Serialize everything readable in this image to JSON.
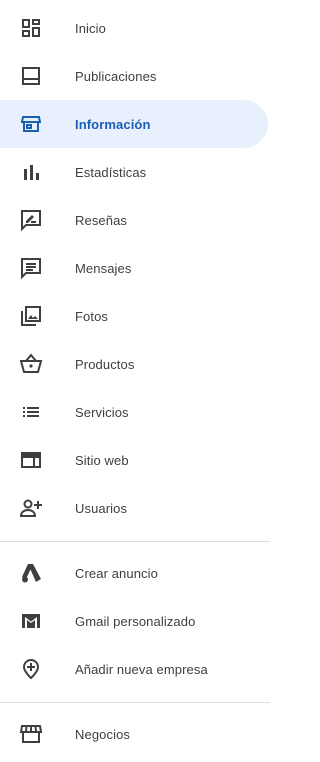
{
  "colors": {
    "active_bg": "#e8f0fe",
    "active_text": "#1a5fb4",
    "icon": "#3c4043",
    "active_icon": "#1a5fb4"
  },
  "nav": {
    "items": [
      {
        "label": "Inicio",
        "icon": "dashboard-icon"
      },
      {
        "label": "Publicaciones",
        "icon": "posts-icon"
      },
      {
        "label": "Información",
        "icon": "storefront-icon",
        "active": true
      },
      {
        "label": "Estadísticas",
        "icon": "bar-chart-icon"
      },
      {
        "label": "Reseñas",
        "icon": "rate-review-icon"
      },
      {
        "label": "Mensajes",
        "icon": "message-icon"
      },
      {
        "label": "Fotos",
        "icon": "photo-library-icon"
      },
      {
        "label": "Productos",
        "icon": "basket-icon"
      },
      {
        "label": "Servicios",
        "icon": "list-icon"
      },
      {
        "label": "Sitio web",
        "icon": "web-icon"
      },
      {
        "label": "Usuarios",
        "icon": "person-add-icon"
      }
    ],
    "secondary": [
      {
        "label": "Crear anuncio",
        "icon": "google-ads-icon"
      },
      {
        "label": "Gmail personalizado",
        "icon": "gmail-icon"
      },
      {
        "label": "Añadir nueva empresa",
        "icon": "add-location-icon"
      }
    ],
    "footer": [
      {
        "label": "Negocios",
        "icon": "store-icon"
      }
    ]
  }
}
